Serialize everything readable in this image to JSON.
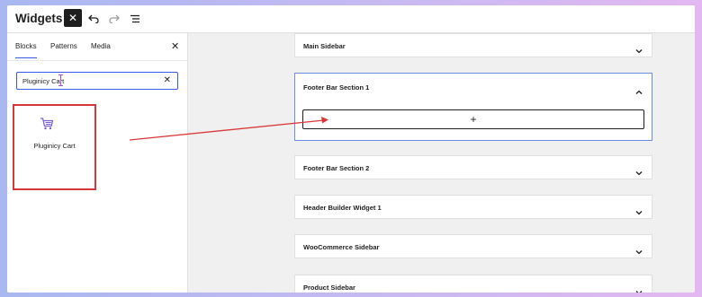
{
  "header": {
    "title": "Widgets",
    "close_glyph": "✕",
    "icons": [
      "undo-icon",
      "redo-icon",
      "list-view-icon"
    ]
  },
  "sidebar": {
    "tabs": [
      {
        "label": "Blocks",
        "active": true
      },
      {
        "label": "Patterns",
        "active": false
      },
      {
        "label": "Media",
        "active": false
      }
    ],
    "close_glyph": "✕",
    "search": {
      "value": "Pluginicy Cart",
      "clear_glyph": "✕"
    },
    "result": {
      "label": "Pluginicy Cart",
      "icon": "cart-icon"
    }
  },
  "widget_areas": [
    {
      "label": "Main Sidebar",
      "expanded": false
    },
    {
      "label": "Footer Bar Section 1",
      "expanded": true,
      "add_glyph": "+"
    },
    {
      "label": "Footer Bar Section 2",
      "expanded": false
    },
    {
      "label": "Header Builder Widget 1",
      "expanded": false
    },
    {
      "label": "WooCommerce Sidebar",
      "expanded": false
    },
    {
      "label": "Product Sidebar",
      "expanded": false
    }
  ],
  "colors": {
    "accent": "#3858e9",
    "annotation": "#d9383a",
    "cart_icon": "#7b5cd6"
  }
}
